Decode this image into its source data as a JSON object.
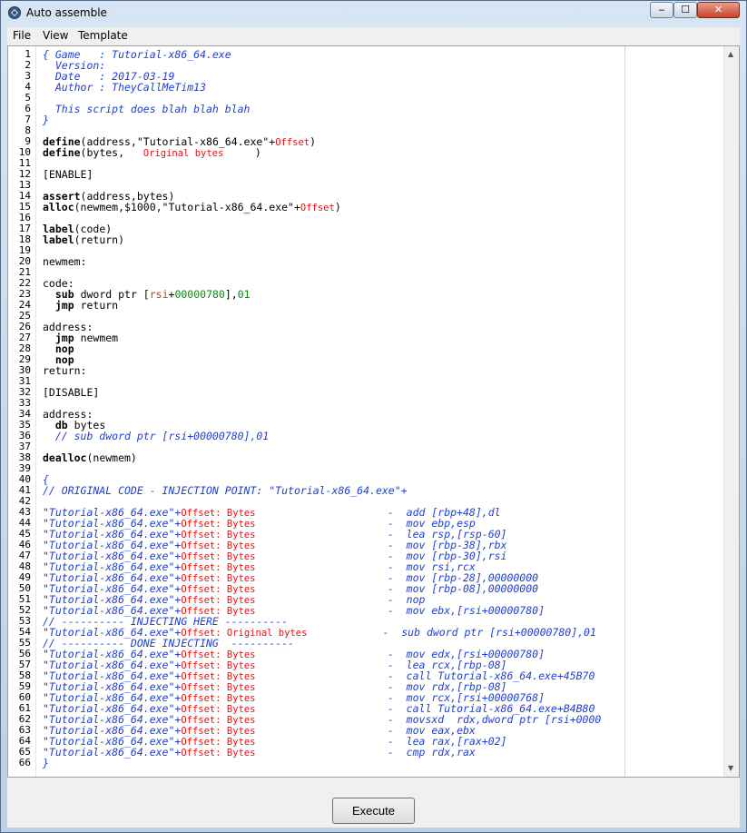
{
  "window": {
    "title": "Auto assemble",
    "buttons": {
      "minimize": "‒",
      "maximize": "☐",
      "close": "✕"
    }
  },
  "menu": [
    "File",
    "View",
    "Template"
  ],
  "colors": {
    "comment": "#1f3fd0",
    "placeholder": "#e11313",
    "register": "#a0522d",
    "number": "#0a8a0a"
  },
  "line_numbers": [
    "1",
    "2",
    "3",
    "4",
    "5",
    "6",
    "7",
    "8",
    "9",
    "10",
    "11",
    "12",
    "13",
    "14",
    "15",
    "16",
    "17",
    "18",
    "19",
    "20",
    "21",
    "22",
    "23",
    "24",
    "25",
    "26",
    "27",
    "28",
    "29",
    "30",
    "31",
    "32",
    "33",
    "34",
    "35",
    "36",
    "37",
    "38",
    "39",
    "40",
    "41",
    "42",
    "43",
    "44",
    "45",
    "46",
    "47",
    "48",
    "49",
    "50",
    "51",
    "52",
    "53",
    "54",
    "55",
    "56",
    "57",
    "58",
    "59",
    "60",
    "61",
    "62",
    "63",
    "64",
    "65",
    "66"
  ],
  "code": [
    [
      {
        "t": "{ Game   : Tutorial-x86_64.exe",
        "s": "c-cmt"
      }
    ],
    [
      {
        "t": "  Version:",
        "s": "c-cmt"
      }
    ],
    [
      {
        "t": "  Date   : 2017-03-19",
        "s": "c-cmt"
      }
    ],
    [
      {
        "t": "  Author : TheyCallMeTim13",
        "s": "c-cmt"
      }
    ],
    [],
    [
      {
        "t": "  This script does blah blah blah",
        "s": "c-cmt"
      }
    ],
    [
      {
        "t": "}",
        "s": "c-cmt"
      }
    ],
    [],
    [
      {
        "t": "define",
        "s": "c-kw"
      },
      {
        "t": "(address,\"Tutorial-x86_64.exe\"+"
      },
      {
        "t": "Offset",
        "s": "c-red"
      },
      {
        "t": ")"
      }
    ],
    [
      {
        "t": "define",
        "s": "c-kw"
      },
      {
        "t": "(bytes,   "
      },
      {
        "t": "Original bytes",
        "s": "c-red"
      },
      {
        "t": "     )"
      }
    ],
    [],
    [
      {
        "t": "[ENABLE]"
      }
    ],
    [],
    [
      {
        "t": "assert",
        "s": "c-kw"
      },
      {
        "t": "(address,bytes)"
      }
    ],
    [
      {
        "t": "alloc",
        "s": "c-kw"
      },
      {
        "t": "(newmem,$1000,\"Tutorial-x86_64.exe\"+"
      },
      {
        "t": "Offset",
        "s": "c-red"
      },
      {
        "t": ")"
      }
    ],
    [],
    [
      {
        "t": "label",
        "s": "c-kw"
      },
      {
        "t": "(code)"
      }
    ],
    [
      {
        "t": "label",
        "s": "c-kw"
      },
      {
        "t": "(return)"
      }
    ],
    [],
    [
      {
        "t": "newmem:"
      }
    ],
    [],
    [
      {
        "t": "code:"
      }
    ],
    [
      {
        "t": "  "
      },
      {
        "t": "sub",
        "s": "c-kw"
      },
      {
        "t": " dword ptr ["
      },
      {
        "t": "rsi",
        "s": "c-brn"
      },
      {
        "t": "+"
      },
      {
        "t": "00000780",
        "s": "c-grn"
      },
      {
        "t": "],"
      },
      {
        "t": "01",
        "s": "c-grn"
      }
    ],
    [
      {
        "t": "  "
      },
      {
        "t": "jmp",
        "s": "c-kw"
      },
      {
        "t": " return"
      }
    ],
    [],
    [
      {
        "t": "address:"
      }
    ],
    [
      {
        "t": "  "
      },
      {
        "t": "jmp",
        "s": "c-kw"
      },
      {
        "t": " newmem"
      }
    ],
    [
      {
        "t": "  "
      },
      {
        "t": "nop",
        "s": "c-kw"
      }
    ],
    [
      {
        "t": "  "
      },
      {
        "t": "nop",
        "s": "c-kw"
      }
    ],
    [
      {
        "t": "return:"
      }
    ],
    [],
    [
      {
        "t": "[DISABLE]"
      }
    ],
    [],
    [
      {
        "t": "address:"
      }
    ],
    [
      {
        "t": "  "
      },
      {
        "t": "db",
        "s": "c-kw"
      },
      {
        "t": " bytes"
      }
    ],
    [
      {
        "t": "  // sub dword ptr [rsi+00000780],01",
        "s": "c-cmt"
      }
    ],
    [],
    [
      {
        "t": "dealloc",
        "s": "c-kw"
      },
      {
        "t": "(newmem)"
      }
    ],
    [],
    [
      {
        "t": "{",
        "s": "c-cmt"
      }
    ],
    [
      {
        "t": "// ORIGINAL CODE - INJECTION POINT: \"Tutorial-x86_64.exe\"+",
        "s": "c-cmt"
      }
    ],
    [],
    [
      {
        "t": "\"Tutorial-x86_64.exe\"+",
        "s": "c-cmt"
      },
      {
        "t": "Offset: Bytes",
        "s": "c-red"
      },
      {
        "t": "                     -  add [rbp+48],dl",
        "s": "c-cmt"
      }
    ],
    [
      {
        "t": "\"Tutorial-x86_64.exe\"+",
        "s": "c-cmt"
      },
      {
        "t": "Offset: Bytes",
        "s": "c-red"
      },
      {
        "t": "                     -  mov ebp,esp",
        "s": "c-cmt"
      }
    ],
    [
      {
        "t": "\"Tutorial-x86_64.exe\"+",
        "s": "c-cmt"
      },
      {
        "t": "Offset: Bytes",
        "s": "c-red"
      },
      {
        "t": "                     -  lea rsp,[rsp-60]",
        "s": "c-cmt"
      }
    ],
    [
      {
        "t": "\"Tutorial-x86_64.exe\"+",
        "s": "c-cmt"
      },
      {
        "t": "Offset: Bytes",
        "s": "c-red"
      },
      {
        "t": "                     -  mov [rbp-38],rbx",
        "s": "c-cmt"
      }
    ],
    [
      {
        "t": "\"Tutorial-x86_64.exe\"+",
        "s": "c-cmt"
      },
      {
        "t": "Offset: Bytes",
        "s": "c-red"
      },
      {
        "t": "                     -  mov [rbp-30],rsi",
        "s": "c-cmt"
      }
    ],
    [
      {
        "t": "\"Tutorial-x86_64.exe\"+",
        "s": "c-cmt"
      },
      {
        "t": "Offset: Bytes",
        "s": "c-red"
      },
      {
        "t": "                     -  mov rsi,rcx",
        "s": "c-cmt"
      }
    ],
    [
      {
        "t": "\"Tutorial-x86_64.exe\"+",
        "s": "c-cmt"
      },
      {
        "t": "Offset: Bytes",
        "s": "c-red"
      },
      {
        "t": "                     -  mov [rbp-28],00000000",
        "s": "c-cmt"
      }
    ],
    [
      {
        "t": "\"Tutorial-x86_64.exe\"+",
        "s": "c-cmt"
      },
      {
        "t": "Offset: Bytes",
        "s": "c-red"
      },
      {
        "t": "                     -  mov [rbp-08],00000000",
        "s": "c-cmt"
      }
    ],
    [
      {
        "t": "\"Tutorial-x86_64.exe\"+",
        "s": "c-cmt"
      },
      {
        "t": "Offset: Bytes",
        "s": "c-red"
      },
      {
        "t": "                     -  nop",
        "s": "c-cmt"
      }
    ],
    [
      {
        "t": "\"Tutorial-x86_64.exe\"+",
        "s": "c-cmt"
      },
      {
        "t": "Offset: Bytes",
        "s": "c-red"
      },
      {
        "t": "                     -  mov ebx,[rsi+00000780]",
        "s": "c-cmt"
      }
    ],
    [
      {
        "t": "// ---------- INJECTING HERE ----------",
        "s": "c-cmt"
      }
    ],
    [
      {
        "t": "\"Tutorial-x86_64.exe\"+",
        "s": "c-cmt"
      },
      {
        "t": "Offset: Original bytes",
        "s": "c-red"
      },
      {
        "t": "            -  sub dword ptr [rsi+00000780],01",
        "s": "c-cmt"
      }
    ],
    [
      {
        "t": "// ---------- DONE INJECTING  ----------",
        "s": "c-cmt"
      }
    ],
    [
      {
        "t": "\"Tutorial-x86_64.exe\"+",
        "s": "c-cmt"
      },
      {
        "t": "Offset: Bytes",
        "s": "c-red"
      },
      {
        "t": "                     -  mov edx,[rsi+00000780]",
        "s": "c-cmt"
      }
    ],
    [
      {
        "t": "\"Tutorial-x86_64.exe\"+",
        "s": "c-cmt"
      },
      {
        "t": "Offset: Bytes",
        "s": "c-red"
      },
      {
        "t": "                     -  lea rcx,[rbp-08]",
        "s": "c-cmt"
      }
    ],
    [
      {
        "t": "\"Tutorial-x86_64.exe\"+",
        "s": "c-cmt"
      },
      {
        "t": "Offset: Bytes",
        "s": "c-red"
      },
      {
        "t": "                     -  call Tutorial-x86_64.exe+45B70",
        "s": "c-cmt"
      }
    ],
    [
      {
        "t": "\"Tutorial-x86_64.exe\"+",
        "s": "c-cmt"
      },
      {
        "t": "Offset: Bytes",
        "s": "c-red"
      },
      {
        "t": "                     -  mov rdx,[rbp-08]",
        "s": "c-cmt"
      }
    ],
    [
      {
        "t": "\"Tutorial-x86_64.exe\"+",
        "s": "c-cmt"
      },
      {
        "t": "Offset: Bytes",
        "s": "c-red"
      },
      {
        "t": "                     -  mov rcx,[rsi+00000768]",
        "s": "c-cmt"
      }
    ],
    [
      {
        "t": "\"Tutorial-x86_64.exe\"+",
        "s": "c-cmt"
      },
      {
        "t": "Offset: Bytes",
        "s": "c-red"
      },
      {
        "t": "                     -  call Tutorial-x86_64.exe+B4B80",
        "s": "c-cmt"
      }
    ],
    [
      {
        "t": "\"Tutorial-x86_64.exe\"+",
        "s": "c-cmt"
      },
      {
        "t": "Offset: Bytes",
        "s": "c-red"
      },
      {
        "t": "                     -  movsxd  rdx,dword ptr [rsi+0000",
        "s": "c-cmt"
      }
    ],
    [
      {
        "t": "\"Tutorial-x86_64.exe\"+",
        "s": "c-cmt"
      },
      {
        "t": "Offset: Bytes",
        "s": "c-red"
      },
      {
        "t": "                     -  mov eax,ebx",
        "s": "c-cmt"
      }
    ],
    [
      {
        "t": "\"Tutorial-x86_64.exe\"+",
        "s": "c-cmt"
      },
      {
        "t": "Offset: Bytes",
        "s": "c-red"
      },
      {
        "t": "                     -  lea rax,[rax+02]",
        "s": "c-cmt"
      }
    ],
    [
      {
        "t": "\"Tutorial-x86_64.exe\"+",
        "s": "c-cmt"
      },
      {
        "t": "Offset: Bytes",
        "s": "c-red"
      },
      {
        "t": "                     -  cmp rdx,rax",
        "s": "c-cmt"
      }
    ],
    [
      {
        "t": "}",
        "s": "c-cmt"
      }
    ]
  ],
  "footer": {
    "execute_label": "Execute"
  },
  "scrollbar": {
    "grip": "⁞⁞⁞"
  }
}
